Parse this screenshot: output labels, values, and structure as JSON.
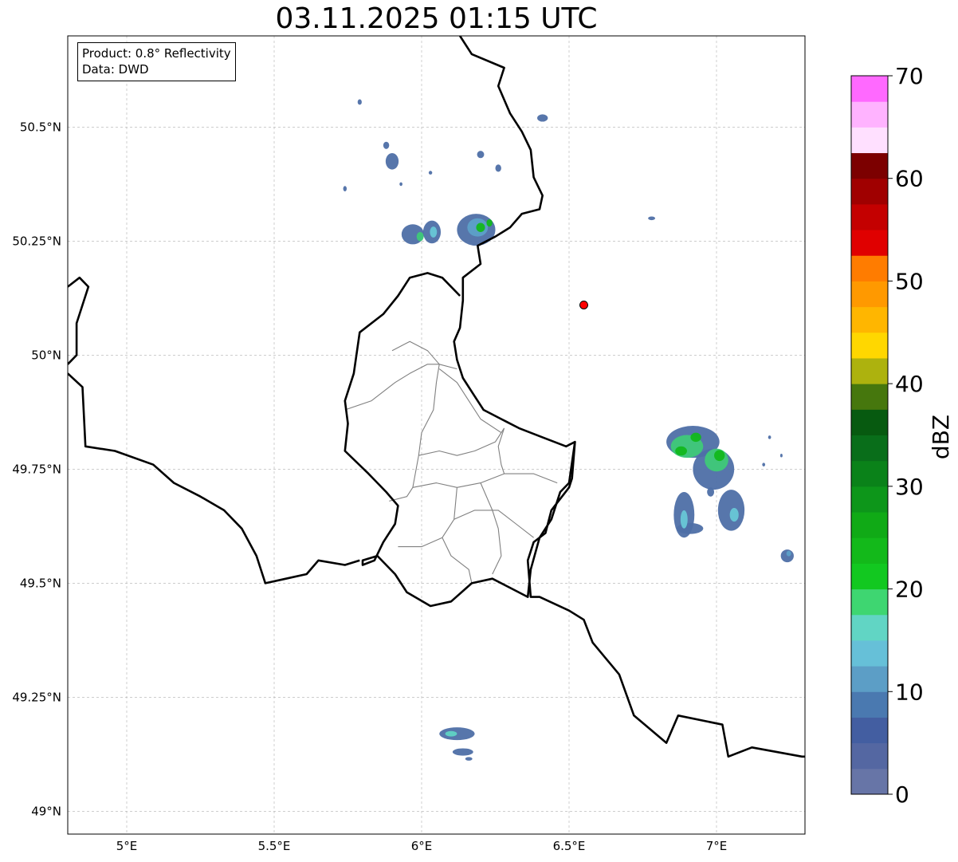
{
  "title": "03.11.2025 01:15 UTC",
  "info": {
    "product_line": "Product: 0.8° Reflectivity",
    "data_line": "Data: DWD"
  },
  "map": {
    "projection": "PlateCarree",
    "lon_range": [
      4.8,
      7.3
    ],
    "lat_range": [
      48.95,
      50.7
    ],
    "grid": true,
    "lon_ticks": [
      {
        "value": 5.0,
        "label": "5°E"
      },
      {
        "value": 5.5,
        "label": "5.5°E"
      },
      {
        "value": 6.0,
        "label": "6°E"
      },
      {
        "value": 6.5,
        "label": "6.5°E"
      },
      {
        "value": 7.0,
        "label": "7°E"
      }
    ],
    "lat_ticks": [
      {
        "value": 49.0,
        "label": "49°N"
      },
      {
        "value": 49.25,
        "label": "49.25°N"
      },
      {
        "value": 49.5,
        "label": "49.5°N"
      },
      {
        "value": 49.75,
        "label": "49.75°N"
      },
      {
        "value": 50.0,
        "label": "50°N"
      },
      {
        "value": 50.25,
        "label": "50.25°N"
      },
      {
        "value": 50.5,
        "label": "50.5°N"
      }
    ],
    "radar_site": {
      "lon": 6.55,
      "lat": 50.11,
      "color": "#ff0000"
    },
    "borders": {
      "be_de": [
        [
          6.13,
          50.7
        ],
        [
          6.17,
          50.66
        ],
        [
          6.28,
          50.63
        ],
        [
          6.26,
          50.59
        ],
        [
          6.3,
          50.53
        ],
        [
          6.34,
          50.49
        ],
        [
          6.37,
          50.45
        ],
        [
          6.38,
          50.39
        ],
        [
          6.41,
          50.35
        ],
        [
          6.4,
          50.32
        ],
        [
          6.34,
          50.31
        ],
        [
          6.3,
          50.28
        ],
        [
          6.25,
          50.26
        ],
        [
          6.19,
          50.24
        ],
        [
          6.2,
          50.2
        ],
        [
          6.14,
          50.17
        ],
        [
          6.14,
          50.12
        ],
        [
          6.13,
          50.06
        ],
        [
          6.11,
          50.03
        ],
        [
          6.12,
          49.99
        ],
        [
          6.14,
          49.95
        ],
        [
          6.18,
          49.91
        ],
        [
          6.21,
          49.88
        ],
        [
          6.27,
          49.86
        ],
        [
          6.33,
          49.84
        ],
        [
          6.41,
          49.82
        ],
        [
          6.49,
          49.8
        ],
        [
          6.52,
          49.81
        ],
        [
          6.51,
          49.73
        ],
        [
          6.5,
          49.71
        ],
        [
          6.44,
          49.66
        ],
        [
          6.42,
          49.61
        ],
        [
          6.38,
          49.59
        ],
        [
          6.36,
          49.55
        ],
        [
          6.37,
          49.47
        ],
        [
          6.4,
          49.47
        ],
        [
          6.5,
          49.44
        ],
        [
          6.55,
          49.42
        ],
        [
          6.58,
          49.37
        ],
        [
          6.67,
          49.3
        ],
        [
          6.72,
          49.21
        ],
        [
          6.83,
          49.15
        ],
        [
          6.87,
          49.21
        ],
        [
          7.02,
          49.19
        ],
        [
          7.04,
          49.12
        ],
        [
          7.12,
          49.14
        ],
        [
          7.29,
          49.12
        ],
        [
          7.3,
          49.12
        ]
      ],
      "be_fr": [
        [
          4.8,
          49.96
        ],
        [
          4.85,
          49.93
        ],
        [
          4.86,
          49.8
        ],
        [
          4.96,
          49.79
        ],
        [
          5.09,
          49.76
        ],
        [
          5.16,
          49.72
        ],
        [
          5.25,
          49.69
        ],
        [
          5.33,
          49.66
        ],
        [
          5.39,
          49.62
        ],
        [
          5.44,
          49.56
        ],
        [
          5.47,
          49.5
        ],
        [
          5.54,
          49.51
        ],
        [
          5.61,
          49.52
        ],
        [
          5.65,
          49.55
        ],
        [
          5.74,
          49.54
        ],
        [
          5.79,
          49.55
        ]
      ],
      "be_fr_w": [
        [
          4.8,
          50.15
        ],
        [
          4.84,
          50.17
        ],
        [
          4.87,
          50.15
        ],
        [
          4.83,
          50.07
        ],
        [
          4.83,
          50.0
        ],
        [
          4.8,
          49.98
        ]
      ],
      "lu_outer": [
        [
          6.13,
          50.13
        ],
        [
          6.07,
          50.17
        ],
        [
          6.02,
          50.18
        ],
        [
          5.96,
          50.17
        ],
        [
          5.92,
          50.13
        ],
        [
          5.87,
          50.09
        ],
        [
          5.79,
          50.05
        ],
        [
          5.77,
          49.96
        ],
        [
          5.74,
          49.9
        ],
        [
          5.75,
          49.85
        ],
        [
          5.74,
          49.79
        ],
        [
          5.82,
          49.74
        ],
        [
          5.88,
          49.7
        ],
        [
          5.92,
          49.67
        ],
        [
          5.91,
          49.63
        ],
        [
          5.87,
          49.59
        ],
        [
          5.84,
          49.55
        ],
        [
          5.8,
          49.54
        ],
        [
          5.8,
          49.55
        ],
        [
          5.85,
          49.56
        ],
        [
          5.91,
          49.52
        ],
        [
          5.95,
          49.48
        ],
        [
          6.03,
          49.45
        ],
        [
          6.1,
          49.46
        ],
        [
          6.17,
          49.5
        ],
        [
          6.24,
          49.51
        ],
        [
          6.3,
          49.49
        ],
        [
          6.36,
          49.47
        ],
        [
          6.37,
          49.53
        ],
        [
          6.4,
          49.6
        ],
        [
          6.44,
          49.64
        ],
        [
          6.47,
          49.7
        ],
        [
          6.5,
          49.72
        ],
        [
          6.52,
          49.81
        ]
      ],
      "lu_cantons": [
        [
          [
            5.74,
            49.88
          ],
          [
            5.83,
            49.9
          ],
          [
            5.91,
            49.94
          ],
          [
            5.96,
            49.96
          ],
          [
            6.02,
            49.98
          ],
          [
            6.06,
            49.98
          ],
          [
            6.12,
            49.97
          ]
        ],
        [
          [
            5.9,
            50.01
          ],
          [
            5.96,
            50.03
          ],
          [
            6.02,
            50.01
          ],
          [
            6.06,
            49.98
          ],
          [
            6.05,
            49.94
          ],
          [
            6.04,
            49.88
          ],
          [
            6.0,
            49.83
          ],
          [
            5.99,
            49.78
          ]
        ],
        [
          [
            6.06,
            49.97
          ],
          [
            6.12,
            49.94
          ],
          [
            6.16,
            49.9
          ],
          [
            6.2,
            49.86
          ],
          [
            6.27,
            49.83
          ]
        ],
        [
          [
            5.99,
            49.78
          ],
          [
            6.06,
            49.79
          ],
          [
            6.12,
            49.78
          ],
          [
            6.18,
            49.79
          ],
          [
            6.25,
            49.81
          ],
          [
            6.28,
            49.84
          ]
        ],
        [
          [
            5.99,
            49.78
          ],
          [
            5.97,
            49.71
          ],
          [
            5.95,
            49.69
          ],
          [
            5.89,
            49.68
          ]
        ],
        [
          [
            5.97,
            49.71
          ],
          [
            6.05,
            49.72
          ],
          [
            6.12,
            49.71
          ],
          [
            6.2,
            49.72
          ],
          [
            6.28,
            49.74
          ],
          [
            6.38,
            49.74
          ],
          [
            6.46,
            49.72
          ]
        ],
        [
          [
            6.12,
            49.71
          ],
          [
            6.11,
            49.64
          ],
          [
            6.07,
            49.6
          ],
          [
            6.0,
            49.58
          ],
          [
            5.92,
            49.58
          ]
        ],
        [
          [
            6.11,
            49.64
          ],
          [
            6.18,
            49.66
          ],
          [
            6.26,
            49.66
          ],
          [
            6.32,
            49.63
          ],
          [
            6.38,
            49.6
          ]
        ],
        [
          [
            6.2,
            49.72
          ],
          [
            6.24,
            49.66
          ],
          [
            6.26,
            49.62
          ],
          [
            6.27,
            49.56
          ],
          [
            6.24,
            49.52
          ]
        ],
        [
          [
            6.07,
            49.6
          ],
          [
            6.1,
            49.56
          ],
          [
            6.16,
            49.53
          ],
          [
            6.17,
            49.5
          ]
        ],
        [
          [
            6.28,
            49.84
          ],
          [
            6.26,
            49.8
          ],
          [
            6.27,
            49.76
          ],
          [
            6.28,
            49.74
          ]
        ]
      ]
    },
    "echo_cells": [
      {
        "lon": 5.79,
        "lat": 50.555,
        "rx": 0.007,
        "ry": 0.006,
        "color": "#4e6fa7"
      },
      {
        "lon": 5.74,
        "lat": 50.365,
        "rx": 0.006,
        "ry": 0.006,
        "color": "#4e6fa7"
      },
      {
        "lon": 5.88,
        "lat": 50.46,
        "rx": 0.01,
        "ry": 0.008,
        "color": "#4e6fa7"
      },
      {
        "lon": 5.9,
        "lat": 50.425,
        "rx": 0.022,
        "ry": 0.018,
        "color": "#4e6fa7"
      },
      {
        "lon": 5.93,
        "lat": 50.375,
        "rx": 0.005,
        "ry": 0.004,
        "color": "#4e6fa7"
      },
      {
        "lon": 6.03,
        "lat": 50.4,
        "rx": 0.006,
        "ry": 0.004,
        "color": "#4e6fa7"
      },
      {
        "lon": 6.2,
        "lat": 50.44,
        "rx": 0.012,
        "ry": 0.008,
        "color": "#4e6fa7"
      },
      {
        "lon": 6.26,
        "lat": 50.41,
        "rx": 0.01,
        "ry": 0.008,
        "color": "#4e6fa7"
      },
      {
        "lon": 6.41,
        "lat": 50.52,
        "rx": 0.018,
        "ry": 0.008,
        "color": "#4e6fa7"
      },
      {
        "lon": 6.78,
        "lat": 50.3,
        "rx": 0.012,
        "ry": 0.004,
        "color": "#4e6fa7"
      },
      {
        "lon": 5.97,
        "lat": 50.265,
        "rx": 0.038,
        "ry": 0.022,
        "color": "#4e6fa7"
      },
      {
        "lon": 6.035,
        "lat": 50.27,
        "rx": 0.03,
        "ry": 0.025,
        "color": "#4e6fa7"
      },
      {
        "lon": 5.995,
        "lat": 50.26,
        "rx": 0.012,
        "ry": 0.01,
        "color": "#3fc978"
      },
      {
        "lon": 6.04,
        "lat": 50.27,
        "rx": 0.012,
        "ry": 0.012,
        "color": "#68c7d6"
      },
      {
        "lon": 6.185,
        "lat": 50.275,
        "rx": 0.065,
        "ry": 0.035,
        "color": "#4e6fa7"
      },
      {
        "lon": 6.19,
        "lat": 50.28,
        "rx": 0.035,
        "ry": 0.02,
        "color": "#5da0c8"
      },
      {
        "lon": 6.2,
        "lat": 50.28,
        "rx": 0.015,
        "ry": 0.01,
        "color": "#12b81c"
      },
      {
        "lon": 6.23,
        "lat": 50.29,
        "rx": 0.01,
        "ry": 0.008,
        "color": "#12b81c"
      },
      {
        "lon": 6.12,
        "lat": 49.17,
        "rx": 0.06,
        "ry": 0.014,
        "color": "#4e6fa7"
      },
      {
        "lon": 6.1,
        "lat": 49.17,
        "rx": 0.02,
        "ry": 0.006,
        "color": "#60d3c4"
      },
      {
        "lon": 6.14,
        "lat": 49.13,
        "rx": 0.035,
        "ry": 0.008,
        "color": "#4e6fa7"
      },
      {
        "lon": 6.16,
        "lat": 49.115,
        "rx": 0.012,
        "ry": 0.004,
        "color": "#4e6fa7"
      },
      {
        "lon": 6.92,
        "lat": 49.81,
        "rx": 0.09,
        "ry": 0.035,
        "color": "#4e6fa7"
      },
      {
        "lon": 6.9,
        "lat": 49.8,
        "rx": 0.055,
        "ry": 0.025,
        "color": "#3fc978"
      },
      {
        "lon": 6.88,
        "lat": 49.79,
        "rx": 0.02,
        "ry": 0.01,
        "color": "#12b81c"
      },
      {
        "lon": 6.93,
        "lat": 49.82,
        "rx": 0.018,
        "ry": 0.01,
        "color": "#12b81c"
      },
      {
        "lon": 6.99,
        "lat": 49.75,
        "rx": 0.07,
        "ry": 0.045,
        "color": "#4e6fa7"
      },
      {
        "lon": 7.0,
        "lat": 49.77,
        "rx": 0.04,
        "ry": 0.025,
        "color": "#3fc978"
      },
      {
        "lon": 7.01,
        "lat": 49.78,
        "rx": 0.018,
        "ry": 0.012,
        "color": "#12b81c"
      },
      {
        "lon": 6.89,
        "lat": 49.65,
        "rx": 0.035,
        "ry": 0.05,
        "color": "#4e6fa7"
      },
      {
        "lon": 6.91,
        "lat": 49.62,
        "rx": 0.045,
        "ry": 0.012,
        "color": "#4e6fa7"
      },
      {
        "lon": 6.89,
        "lat": 49.64,
        "rx": 0.012,
        "ry": 0.02,
        "color": "#68c7d6"
      },
      {
        "lon": 7.05,
        "lat": 49.66,
        "rx": 0.045,
        "ry": 0.045,
        "color": "#4e6fa7"
      },
      {
        "lon": 7.06,
        "lat": 49.65,
        "rx": 0.015,
        "ry": 0.015,
        "color": "#68c7d6"
      },
      {
        "lon": 6.98,
        "lat": 49.7,
        "rx": 0.012,
        "ry": 0.01,
        "color": "#4e6fa7"
      },
      {
        "lon": 7.18,
        "lat": 49.82,
        "rx": 0.005,
        "ry": 0.004,
        "color": "#4e6fa7"
      },
      {
        "lon": 7.22,
        "lat": 49.78,
        "rx": 0.004,
        "ry": 0.004,
        "color": "#4e6fa7"
      },
      {
        "lon": 7.16,
        "lat": 49.76,
        "rx": 0.005,
        "ry": 0.004,
        "color": "#4e6fa7"
      },
      {
        "lon": 7.24,
        "lat": 49.56,
        "rx": 0.022,
        "ry": 0.014,
        "color": "#4e6fa7"
      },
      {
        "lon": 7.245,
        "lat": 49.565,
        "rx": 0.008,
        "ry": 0.006,
        "color": "#5da0c8"
      }
    ]
  },
  "colorbar": {
    "label": "dBZ",
    "ticks": [
      {
        "value": 0,
        "label": "0"
      },
      {
        "value": 10,
        "label": "10"
      },
      {
        "value": 20,
        "label": "20"
      },
      {
        "value": 30,
        "label": "30"
      },
      {
        "value": 40,
        "label": "40"
      },
      {
        "value": 50,
        "label": "50"
      },
      {
        "value": 60,
        "label": "60"
      },
      {
        "value": 70,
        "label": "70"
      }
    ],
    "range": [
      0,
      70
    ],
    "step": 2.5,
    "colors": [
      "#6775a7",
      "#5467a2",
      "#435ea1",
      "#4a79b0",
      "#5c9ec6",
      "#66c0d8",
      "#61d5c4",
      "#3ed671",
      "#12c820",
      "#13b91a",
      "#10aa16",
      "#0d961a",
      "#0a8219",
      "#096e1a",
      "#075a10",
      "#46770d",
      "#adb20e",
      "#ffd700",
      "#ffb600",
      "#ff9900",
      "#ff7c00",
      "#e00000",
      "#c40000",
      "#a00000",
      "#7c0000",
      "#ffe0ff",
      "#ffb3ff",
      "#ff69ff",
      "#e83be8"
    ]
  }
}
